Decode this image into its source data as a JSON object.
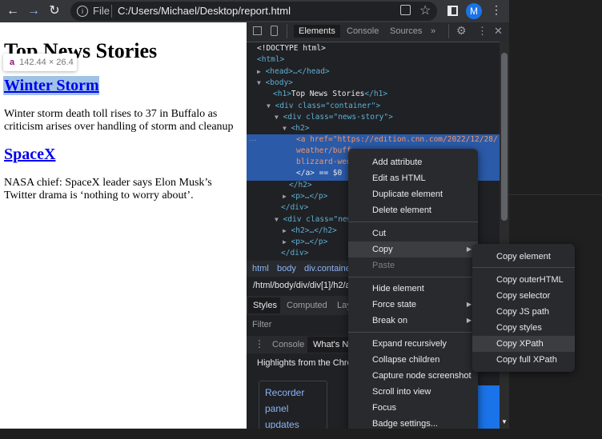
{
  "browser": {
    "file_label": "File",
    "url": "C:/Users/Michael/Desktop/report.html",
    "avatar_letter": "M"
  },
  "page": {
    "title": "Top News Stories",
    "tooltip_tag": "a",
    "tooltip_size": "142.44 × 26.4",
    "stories": [
      {
        "heading": "Winter Storm",
        "text": "Winter storm death toll rises to 37 in Buffalo as criticism arises over handling of storm and cleanup"
      },
      {
        "heading": "SpaceX",
        "text": "NASA chief: SpaceX leader says Elon Musk’s Twitter drama is ‘nothing to worry about’."
      }
    ]
  },
  "devtools": {
    "tabs": [
      "Elements",
      "Console",
      "Sources"
    ],
    "more": "»",
    "code": {
      "doctype": "<!DOCTYPE html>",
      "html": "<html>",
      "head": "<head>…</head>",
      "body": "<body>",
      "h1_open": "<h1>",
      "h1_text": "Top News Stories",
      "h1_close": "</h1>",
      "div_container": "<div class=\"container\">",
      "div_news": "<div class=\"news-story\">",
      "h2": "<h2>",
      "a_line1": "<a href=\"https://edition.cnn.com/2022/12/28/",
      "a_line2": "weather/buff",
      "a_line3": "blizzard-wed",
      "a_line4": "</a> == $0",
      "h2_close": "</h2>",
      "p_collapsed": "<p>…</p>",
      "div_close": "</div>",
      "div_news2": "<div class=\"news",
      "h2_collapsed": "<h2>…</h2>",
      "p_collapsed2": "<p>…</p>",
      "div_close2": "</div>"
    },
    "breadcrumbs": [
      "html",
      "body",
      "div.container"
    ],
    "xpath": "/html/body/div/div[1]/h2/a",
    "subtabs": [
      "Styles",
      "Computed",
      "Lay"
    ],
    "filter_placeholder": "Filter",
    "drawer_tabs": [
      "Console",
      "What's Ne"
    ],
    "highlights": "Highlights from the Chron",
    "recorder": [
      "Recorder",
      "panel",
      "updates"
    ]
  },
  "context_menu": {
    "items": [
      "Add attribute",
      "Edit as HTML",
      "Duplicate element",
      "Delete element",
      "Cut",
      "Copy",
      "Paste",
      "Hide element",
      "Force state",
      "Break on",
      "Expand recursively",
      "Collapse children",
      "Capture node screenshot",
      "Scroll into view",
      "Focus",
      "Badge settings..."
    ]
  },
  "copy_submenu": {
    "items": [
      "Copy element",
      "Copy outerHTML",
      "Copy selector",
      "Copy JS path",
      "Copy styles",
      "Copy XPath",
      "Copy full XPath"
    ]
  },
  "colors": {
    "accent": "#1a73e8",
    "selection": "#2b5aa8"
  }
}
